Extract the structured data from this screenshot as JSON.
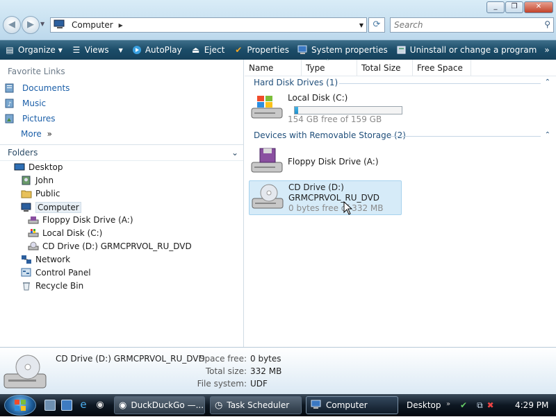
{
  "window": {
    "minimize": "_",
    "maximize": "❐",
    "close": "✕"
  },
  "nav": {
    "back": "◀",
    "forward": "▶"
  },
  "address": {
    "location": "Computer"
  },
  "search": {
    "placeholder": "Search"
  },
  "toolbar": {
    "organize": "Organize",
    "views": "Views",
    "autoplay": "AutoPlay",
    "eject": "Eject",
    "properties": "Properties",
    "system_properties": "System properties",
    "uninstall": "Uninstall or change a program",
    "more": "»",
    "help": "?"
  },
  "favorites": {
    "title": "Favorite Links",
    "items": [
      {
        "label": "Documents"
      },
      {
        "label": "Music"
      },
      {
        "label": "Pictures"
      }
    ],
    "more": "More"
  },
  "folders": {
    "title": "Folders",
    "tree": [
      {
        "label": "Desktop"
      },
      {
        "label": "John"
      },
      {
        "label": "Public"
      },
      {
        "label": "Computer"
      },
      {
        "label": "Floppy Disk Drive (A:)"
      },
      {
        "label": "Local Disk (C:)"
      },
      {
        "label": "CD Drive (D:) GRMCPRVOL_RU_DVD"
      },
      {
        "label": "Network"
      },
      {
        "label": "Control Panel"
      },
      {
        "label": "Recycle Bin"
      }
    ]
  },
  "columns": [
    "Name",
    "Type",
    "Total Size",
    "Free Space"
  ],
  "groups": {
    "hard": "Hard Disk Drives (1)",
    "removable": "Devices with Removable Storage (2)"
  },
  "drives": {
    "local": {
      "name": "Local Disk (C:)",
      "free": "154 GB free of 159 GB",
      "used_fraction": 0.03
    },
    "floppy": {
      "name": "Floppy Disk Drive (A:)"
    },
    "cd": {
      "name": "CD Drive (D:)",
      "label": "GRMCPRVOL_RU_DVD",
      "free": "0 bytes free of 332 MB"
    }
  },
  "details": {
    "name": "CD Drive (D:) GRMCPRVOL_RU_DVD",
    "space_free_label": "Space free:",
    "space_free": "0 bytes",
    "total_size_label": "Total size:",
    "total_size": "332 MB",
    "file_system_label": "File system:",
    "file_system": "UDF"
  },
  "taskbar": {
    "tasks": [
      {
        "label": "DuckDuckGo —..."
      },
      {
        "label": "Task Scheduler"
      },
      {
        "label": "Computer"
      }
    ],
    "desktop": "Desktop",
    "clock": "4:29 PM"
  },
  "colors": {
    "accent": "#1a5ea8",
    "toolbar": "#1b4c68",
    "selection": "#d6ebf8"
  }
}
